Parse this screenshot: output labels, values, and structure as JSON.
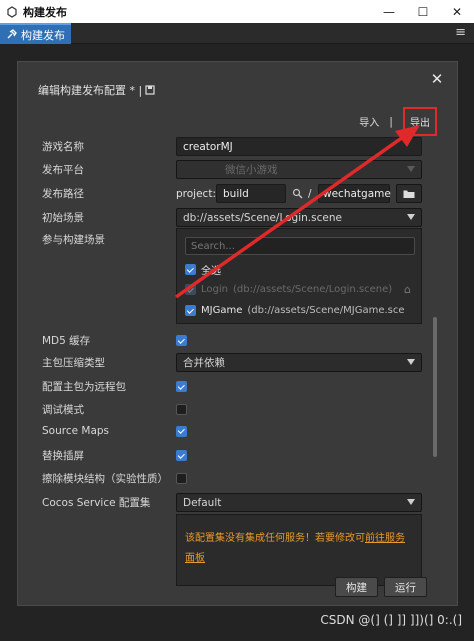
{
  "window": {
    "title": "构建发布",
    "minimize": "—",
    "maximize": "☐",
    "close": "✕"
  },
  "tab": {
    "label": "构建发布",
    "menu": "≡"
  },
  "dialog": {
    "title": "编辑构建发布配置 * |",
    "close": "✕",
    "import_label": "导入",
    "separator": "|",
    "export_label": "导出"
  },
  "form": {
    "game_name": {
      "label": "游戏名称",
      "value": "creatorMJ"
    },
    "platform": {
      "label": "发布平台",
      "value": "微信小游戏"
    },
    "path": {
      "label": "发布路径",
      "prefix": "project://",
      "value": "build",
      "slash": "/",
      "folder": "wechatgame"
    },
    "start_scene": {
      "label": "初始场景",
      "value": "db://assets/Scene/Login.scene"
    },
    "scenes": {
      "label": "参与构建场景",
      "search_placeholder": "Search...",
      "select_all": "全选",
      "items": [
        {
          "name": "Login",
          "path": "(db://assets/Scene/Login.scene)"
        },
        {
          "name": "MJGame",
          "path": "(db://assets/Scene/MJGame.sce"
        }
      ]
    },
    "md5": {
      "label": "MD5 缓存"
    },
    "compression": {
      "label": "主包压缩类型",
      "value": "合并依赖"
    },
    "remote_bundle": {
      "label": "配置主包为远程包"
    },
    "debug": {
      "label": "调试模式"
    },
    "source_maps": {
      "label": "Source Maps"
    },
    "replace_splash": {
      "label": "替换插屏"
    },
    "erase_module": {
      "label": "擦除模块结构（实验性质）"
    },
    "cocos_service": {
      "label": "Cocos Service 配置集",
      "value": "Default"
    },
    "warning": {
      "text": "该配置集没有集成任何服务！若要修改可",
      "link": "前往服务面板"
    }
  },
  "buttons": {
    "build": "构建",
    "run": "运行"
  },
  "watermark": "CSDN @(] (] ]] ]])(] 0:.(]",
  "colors": {
    "accent": "#3b7bd0",
    "warning": "#e89a2a",
    "annotation": "#e02a2a"
  }
}
